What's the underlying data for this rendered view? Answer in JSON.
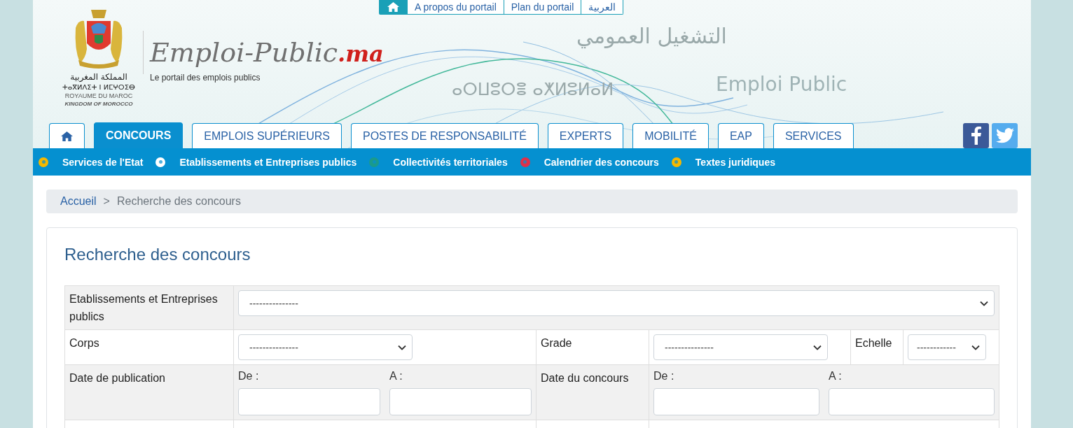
{
  "top_links": [
    {
      "kind": "home"
    },
    {
      "kind": "link",
      "label": "A propos du portail"
    },
    {
      "kind": "link",
      "label": "Plan du portail"
    },
    {
      "kind": "link",
      "label": "العربية"
    }
  ],
  "logo": {
    "arabic": "المملكة المغربية",
    "tifinagh": "ⵜⴰⴳⵍⴷⵉⵜ ⵏ ⵍⵎⵖⵔⵉⴱ",
    "french": "ROYAUME DU MAROC",
    "english": "KINGDOM OF MOROCCO"
  },
  "brand": {
    "name": "Emploi-Public",
    "tld": ".ma",
    "tagline": "Le portail des emplois publics"
  },
  "banner": {
    "arabic": "التشغيل العمومي",
    "tifinagh": "ⴰⵔⵡⵓⵔⴻ ⴰⵅⵍⵓⵍⴰⵍ",
    "latin": "Emploi Public"
  },
  "tabs": [
    {
      "kind": "home",
      "selected": false
    },
    {
      "kind": "text",
      "label": "CONCOURS",
      "selected": true
    },
    {
      "kind": "text",
      "label": "EMPLOIS SUPÉRIEURS",
      "selected": false
    },
    {
      "kind": "text",
      "label": "POSTES DE RESPONSABILITÉ",
      "selected": false
    },
    {
      "kind": "text",
      "label": "EXPERTS",
      "selected": false
    },
    {
      "kind": "text",
      "label": "MOBILITÉ",
      "selected": false
    },
    {
      "kind": "text",
      "label": "EAP",
      "selected": false
    },
    {
      "kind": "text",
      "label": "SERVICES",
      "selected": false
    }
  ],
  "social": [
    {
      "kind": "facebook"
    },
    {
      "kind": "twitter"
    }
  ],
  "subnav": [
    {
      "label": "Services de l'Etat",
      "color": "#f5b800"
    },
    {
      "label": "Etablissements et Entreprises publics",
      "color": "#ffffff"
    },
    {
      "label": "Collectivités territoriales",
      "color": "#1a9a8c"
    },
    {
      "label": "Calendrier des concours",
      "color": "#e0304a"
    },
    {
      "label": "Textes juridiques",
      "color": "#f5b800"
    }
  ],
  "breadcrumb": {
    "items": [
      {
        "kind": "link",
        "label": "Accueil"
      },
      {
        "kind": "current",
        "label": "Recherche des concours"
      }
    ],
    "separator": ">"
  },
  "search": {
    "title": "Recherche des concours",
    "establishment": {
      "label": "Etablissements et Entreprises publics",
      "value": "---------------"
    },
    "corps": {
      "label": "Corps",
      "value": "---------------"
    },
    "grade": {
      "label": "Grade",
      "value": "---------------"
    },
    "echelle": {
      "label": "Echelle",
      "value": "------------"
    },
    "date_publication": {
      "label": "Date de publication",
      "from": "De :",
      "to": "A :"
    },
    "date_concours": {
      "label": "Date du concours",
      "from": "De :",
      "to": "A :"
    }
  }
}
